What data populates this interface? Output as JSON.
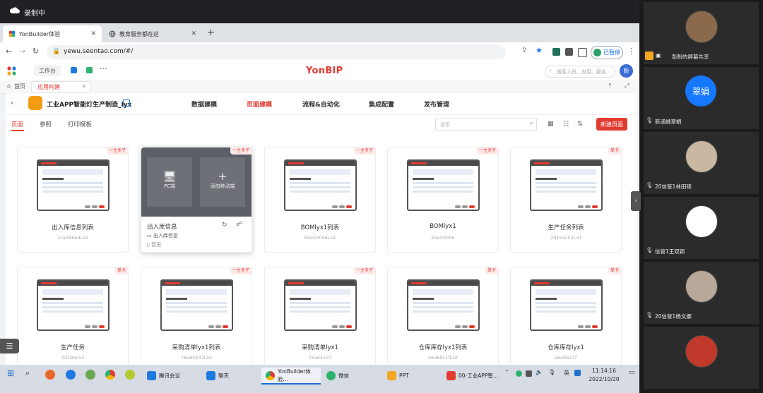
{
  "recording": {
    "label": "录制中"
  },
  "browser": {
    "tabs": [
      {
        "label": "YonBuilder体验",
        "active": true
      },
      {
        "label": "教育服务都在这",
        "active": false
      }
    ],
    "url": "yewu.seentao.com/#/",
    "profile_label": "已暂停"
  },
  "topnav": {
    "workbench": "工作台",
    "brand": "YonBIP",
    "search_placeholder": "搜索人员、应用、服务",
    "avatar": "盼"
  },
  "breadcrumbs": {
    "home": "首页",
    "app_tab": "应用构建"
  },
  "app": {
    "title": "工业APP智能灯生产制造_lyx",
    "menu": [
      "数据建模",
      "页面建模",
      "流程&自动化",
      "集成配置",
      "发布管理"
    ],
    "active_menu": 1
  },
  "subtabs": {
    "items": [
      "页面",
      "参照",
      "打印模板"
    ],
    "active": 0
  },
  "toolbar": {
    "search_placeholder": "搜索",
    "new_page": "新建页面"
  },
  "cards": [
    {
      "name": "出入库信息列表",
      "sub": "1ca346bdList",
      "badge": "一主多子"
    },
    {
      "name": "出入库信息",
      "sub": "",
      "badge": "一主多子",
      "hover": true,
      "pc_label": "PC端",
      "mobile_label": "添加移动端",
      "line1": "出入库信息",
      "line2": "暂无"
    },
    {
      "name": "BOMlyx1列表",
      "sub": "b9e50056List",
      "badge": "一主多子"
    },
    {
      "name": "BOMlyx1",
      "sub": "b9e50056",
      "badge": "一主多子"
    },
    {
      "name": "生产任务列表",
      "sub": "2d194c53List",
      "badge": "单卡"
    },
    {
      "name": "生产任务",
      "sub": "2d194c53",
      "badge": "单卡"
    },
    {
      "name": "采购清单lyx1列表",
      "sub": "78a64237List",
      "badge": "一主多子"
    },
    {
      "name": "采购清单lyx1",
      "sub": "78a64237",
      "badge": "一主多子"
    },
    {
      "name": "仓库库存lyx1列表",
      "sub": "e6d69c1fList",
      "badge": "单卡"
    },
    {
      "name": "仓库库存lyx1",
      "sub": "e6d69c1f",
      "badge": "单卡"
    }
  ],
  "taskbar": {
    "apps": [
      "腾讯会议",
      "聊天",
      "YonBuilder体验...",
      "微信",
      "PPT",
      "00-工业APP智..."
    ],
    "tray_lang": "英",
    "time": "11:14:16",
    "date": "2022/10/20"
  },
  "participants": [
    {
      "name": "彭盼的屏幕共享",
      "avatar_text": "",
      "color": "#8a6a4a"
    },
    {
      "name": "新涵姚翠娟",
      "avatar_text": "翠娟",
      "color": "#1677ff"
    },
    {
      "name": "20信管1林田硕",
      "avatar_text": "",
      "color": "#c9b7a2"
    },
    {
      "name": "信管1王双颖",
      "avatar_text": "",
      "color": "#ffffff"
    },
    {
      "name": "20信管1杨文娜",
      "avatar_text": "",
      "color": "#b8a89a"
    },
    {
      "name": "",
      "avatar_text": "",
      "color": "#c0392b"
    }
  ]
}
